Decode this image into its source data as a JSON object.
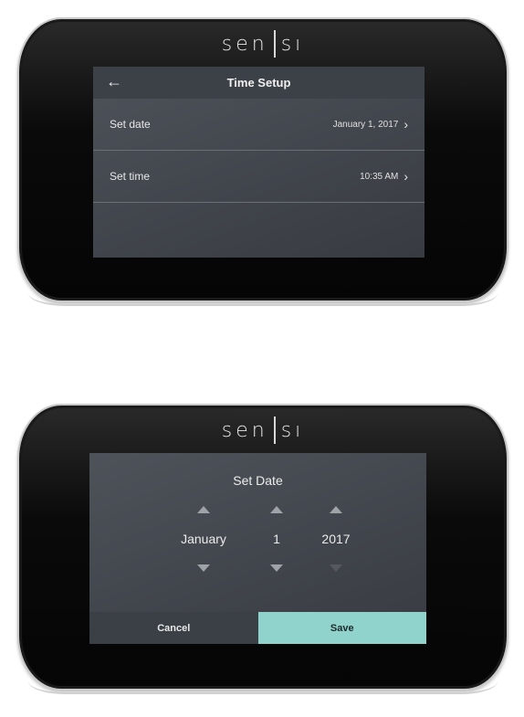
{
  "brand": {
    "left": "sen",
    "right": "sı"
  },
  "time_setup": {
    "title": "Time Setup",
    "back_icon": "back-arrow-icon",
    "rows": [
      {
        "label": "Set date",
        "value": "January 1, 2017"
      },
      {
        "label": "Set time",
        "value": "10:35 AM"
      }
    ]
  },
  "set_date": {
    "title": "Set Date",
    "month": "January",
    "day": "1",
    "year": "2017",
    "cancel_label": "Cancel",
    "save_label": "Save"
  },
  "colors": {
    "screen": "#44484f",
    "save_button": "#8fd3cc",
    "cancel_button": "#3b3f46"
  }
}
